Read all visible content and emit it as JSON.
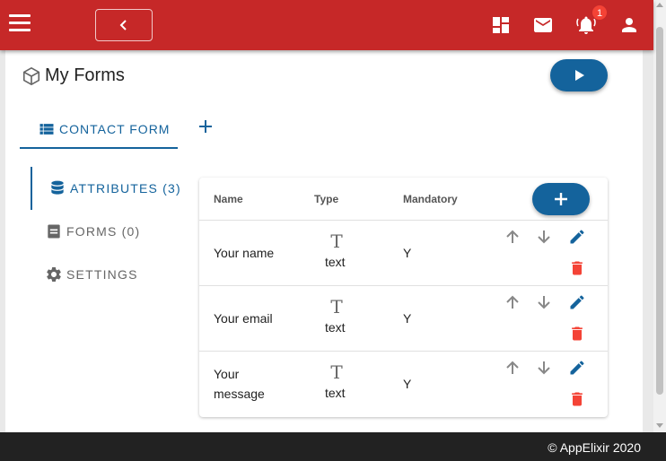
{
  "appbar": {
    "color": "#c62828",
    "icons": [
      "menu-icon",
      "chevron-left-icon",
      "dashboard-icon",
      "mail-icon",
      "bell-icon",
      "person-icon"
    ],
    "notification_count": "1"
  },
  "page": {
    "title": "My Forms",
    "title_icon": "cube-icon",
    "run_button_icon": "play-icon",
    "accent_color": "#14639c"
  },
  "tabs": [
    {
      "label": "CONTACT FORM",
      "icon": "list-icon",
      "active": true
    }
  ],
  "side_nav": [
    {
      "label": "ATTRIBUTES (3)",
      "icon": "database-icon",
      "active": true
    },
    {
      "label": "FORMS (0)",
      "icon": "form-icon",
      "active": false
    },
    {
      "label": "SETTINGS",
      "icon": "gear-icon",
      "active": false
    }
  ],
  "table": {
    "columns": [
      "Name",
      "Type",
      "Mandatory"
    ],
    "rows": [
      {
        "name": "Your name",
        "type_glyph": "T",
        "type": "text",
        "mandatory": "Y"
      },
      {
        "name": "Your email",
        "type_glyph": "T",
        "type": "text",
        "mandatory": "Y"
      },
      {
        "name": "Your message",
        "type_glyph": "T",
        "type": "text",
        "mandatory": "Y"
      }
    ],
    "row_actions": [
      "arrow-up-icon",
      "arrow-down-icon",
      "edit-icon",
      "delete-icon"
    ],
    "delete_color": "#f44336"
  },
  "footer": {
    "copyright": "© AppElixir 2020"
  }
}
